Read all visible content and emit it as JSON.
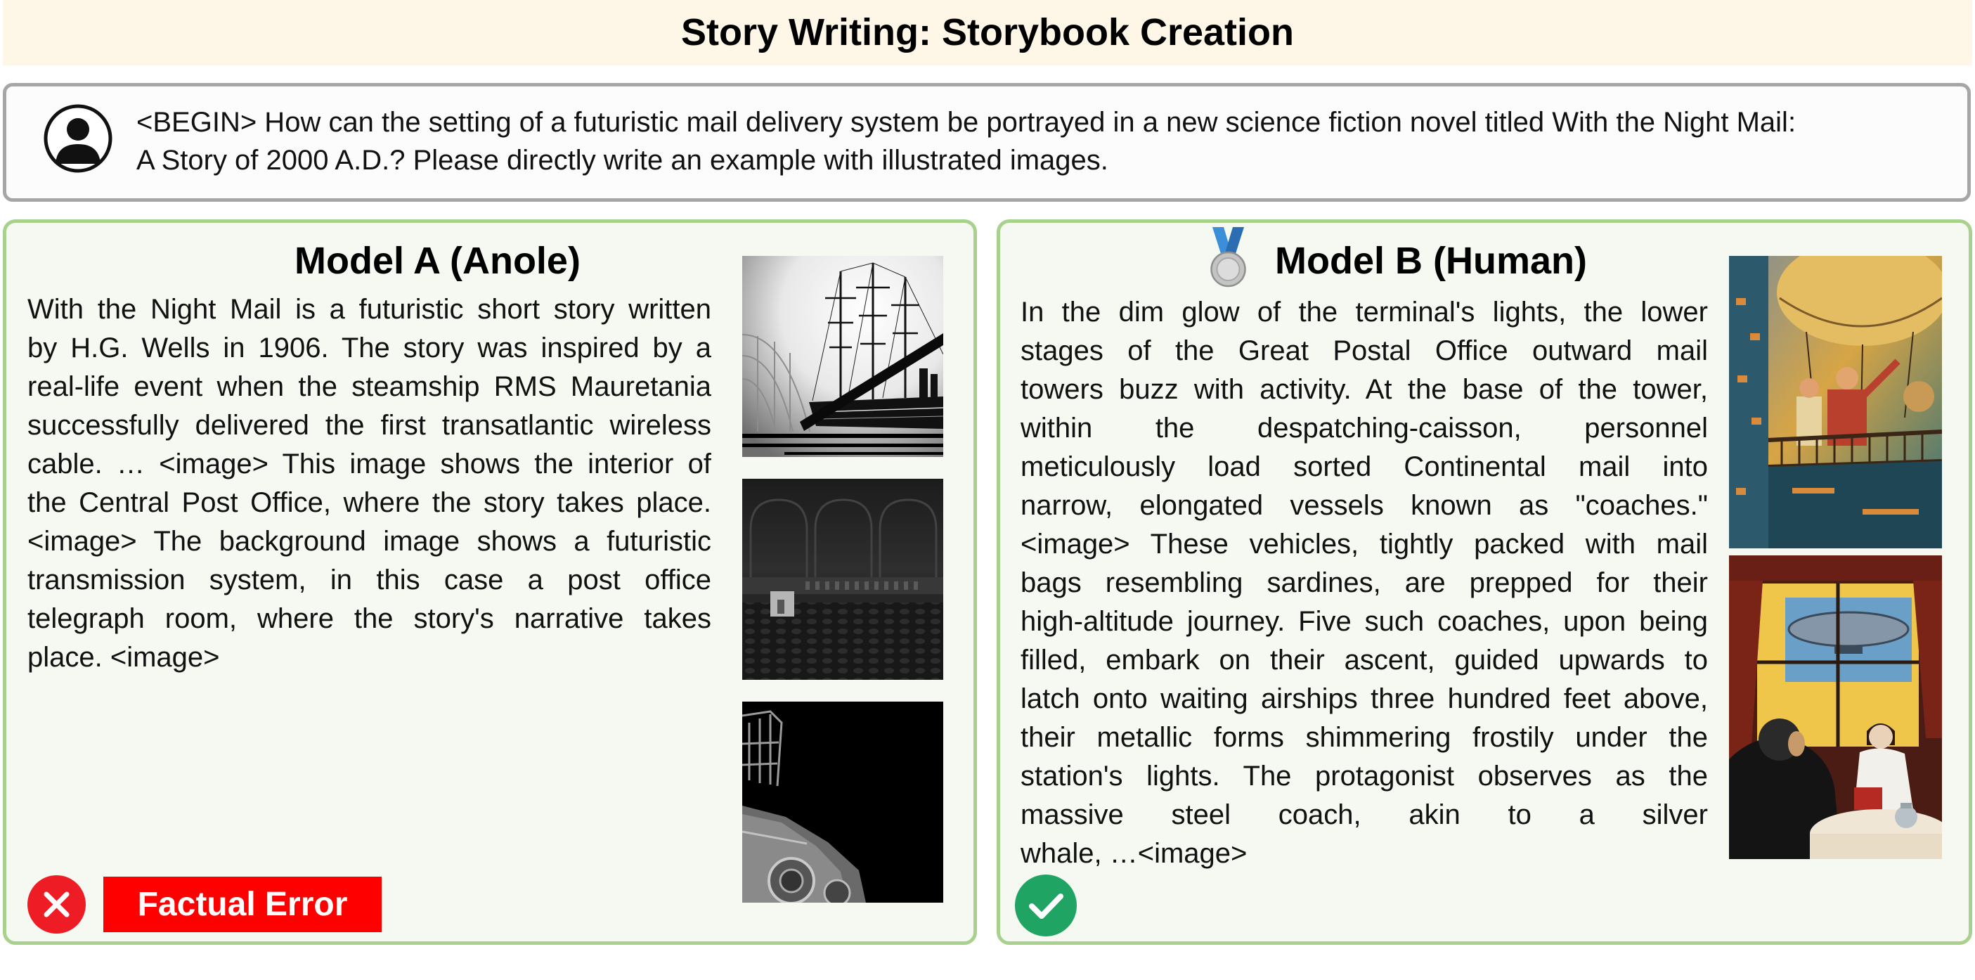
{
  "header": {
    "title": "Story Writing: Storybook Creation"
  },
  "prompt": {
    "avatar_icon": "user-avatar-icon",
    "lines": [
      "<BEGIN> How can the setting of a futuristic mail delivery system be portrayed in a new science fiction novel titled With the Night Mail:",
      "A Story of 2000 A.D.? Please directly write an example with illustrated images."
    ]
  },
  "model_a": {
    "title": "Model A (Anole)",
    "text_lines": [
      "With the Night Mail is a futuristic short story written",
      "by H.G. Wells in 1906.  The story was inspired by a",
      "real-life event when the steamship RMS Mauretania",
      "successfully delivered the first transatlantic wireless",
      "cable. … <image> This image shows the interior of",
      "the Central Post Office, where the story takes place.",
      "<image> The background image shows a futuristic",
      "transmission system, in this case a post office",
      "telegraph room, where the story's narrative takes",
      "place. <image>"
    ],
    "verdict_icon": "x-circle-icon",
    "verdict_label": "Factual Error"
  },
  "model_b": {
    "title": "Model B (Human)",
    "rank_icon": "second-place-medal-icon",
    "text_lines": [
      "In the dim glow of the terminal's lights, the lower",
      "stages of the Great Postal Office outward mail",
      "towers buzz with activity. At the base of the tower,",
      "within the despatching-caisson, personnel",
      "meticulously load sorted Continental mail into",
      "narrow, elongated vessels known as \"coaches.\"",
      "<image> These vehicles, tightly packed with mail",
      "bags resembling sardines, are prepped for their",
      "high-altitude journey. Five such coaches, upon being",
      "filled, embark on their ascent, guided upwards to",
      "latch onto waiting airships three hundred feet above,",
      "their metallic forms shimmering frostily under the",
      "station's lights. The protagonist observes as the",
      "massive steel coach, akin to a silver",
      "whale, …<image>"
    ],
    "verdict_icon": "check-circle-icon"
  },
  "colors": {
    "banner_background": "#fef6e6",
    "prompt_border": "#a6a6a6",
    "panel_border": "#a9d18e",
    "panel_background": "#f5f9f1",
    "error_red": "#ff0000",
    "error_circle_red": "#ee1c25",
    "check_green": "#1fa463",
    "medal_ribbon": "#3b8fd9",
    "medal_silver": "#c4c4c4"
  }
}
